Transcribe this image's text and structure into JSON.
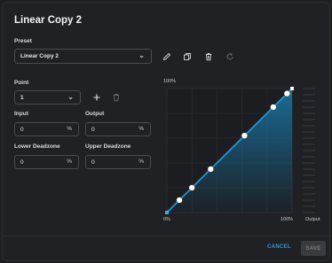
{
  "dialog": {
    "title": "Linear Copy 2"
  },
  "preset": {
    "label": "Preset",
    "selected": "Linear Copy 2",
    "chevron": "chevron-down-icon",
    "actions": [
      "pencil-icon",
      "copy-icon",
      "trash-icon",
      "reset-icon"
    ]
  },
  "point": {
    "label": "Point",
    "selected": "1",
    "add_icon": "plus-icon",
    "delete_icon": "trash-icon"
  },
  "input": {
    "label": "Input",
    "value": "0",
    "unit": "%"
  },
  "output": {
    "label": "Output",
    "value": "0",
    "unit": "%"
  },
  "lower_deadzone": {
    "label": "Lower Deadzone",
    "value": "0",
    "unit": "%"
  },
  "upper_deadzone": {
    "label": "Upper Deadzone",
    "value": "0",
    "unit": "%"
  },
  "chart_data": {
    "type": "line",
    "y_top_label": "100%",
    "x_start_label": "0%",
    "x_end_label": "100%",
    "output_label": "Output",
    "x": [
      0,
      10,
      20,
      35,
      62,
      85,
      96,
      100
    ],
    "y": [
      0,
      10,
      20,
      35,
      62,
      85,
      96,
      100
    ],
    "xlim": [
      0,
      100
    ],
    "ylim": [
      0,
      100
    ],
    "colors": {
      "line": "#1f95d8",
      "fill": "#1a6f9c",
      "point": "#ffffff"
    }
  },
  "footer": {
    "cancel": "CANCEL",
    "save": "SAVE"
  }
}
